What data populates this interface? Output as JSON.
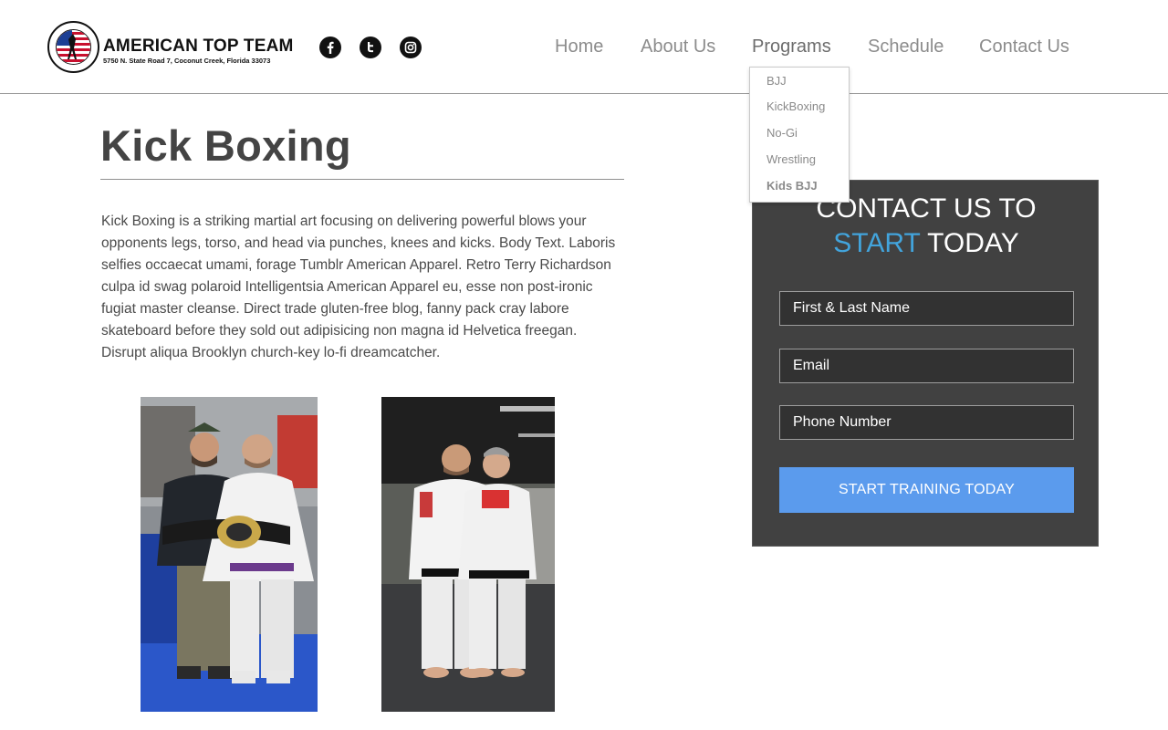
{
  "header": {
    "logo": {
      "name": "AMERICAN TOP TEAM",
      "address": "5750 N. State Road 7, Coconut Creek, Florida 33073",
      "seal_text": "AMERICAN TOP TEAM"
    },
    "social": [
      {
        "icon": "facebook-icon",
        "glyph": "f"
      },
      {
        "icon": "twitter-icon",
        "glyph": "t"
      },
      {
        "icon": "instagram-icon",
        "glyph": "◎"
      }
    ],
    "nav": [
      {
        "label": "Home"
      },
      {
        "label": "About Us"
      },
      {
        "label": "Programs",
        "active": true
      },
      {
        "label": "Schedule"
      },
      {
        "label": "Contact Us"
      }
    ],
    "programs_menu": [
      "BJJ",
      "KickBoxing",
      "No-Gi",
      "Wrestling",
      "Kids BJJ"
    ]
  },
  "main": {
    "title": "Kick Boxing",
    "body": "Kick Boxing is a striking martial art focusing on delivering powerful blows your opponents legs, torso, and head via punches, knees and kicks. Body Text. Laboris selfies occaecat umami, forage Tumblr American Apparel. Retro Terry Richardson culpa id swag polaroid Intelligentsia American Apparel eu, esse non post-ironic fugiat master cleanse. Direct trade gluten-free blog, fanny pack cray labore skateboard before they sold out adipisicing non magna id Helvetica freegan. Disrupt aliqua Brooklyn church-key lo-fi dreamcatcher."
  },
  "contact_panel": {
    "heading_line1": "CONTACT US TO",
    "heading_accent": "START",
    "heading_rest": " TODAY",
    "name_placeholder": "First & Last Name",
    "email_placeholder": "Email",
    "phone_placeholder": "Phone Number",
    "submit_label": "START TRAINING TODAY"
  },
  "colors": {
    "accent_blue": "#42a4dc",
    "button_blue": "#5b9bed",
    "panel_bg": "#414141"
  }
}
